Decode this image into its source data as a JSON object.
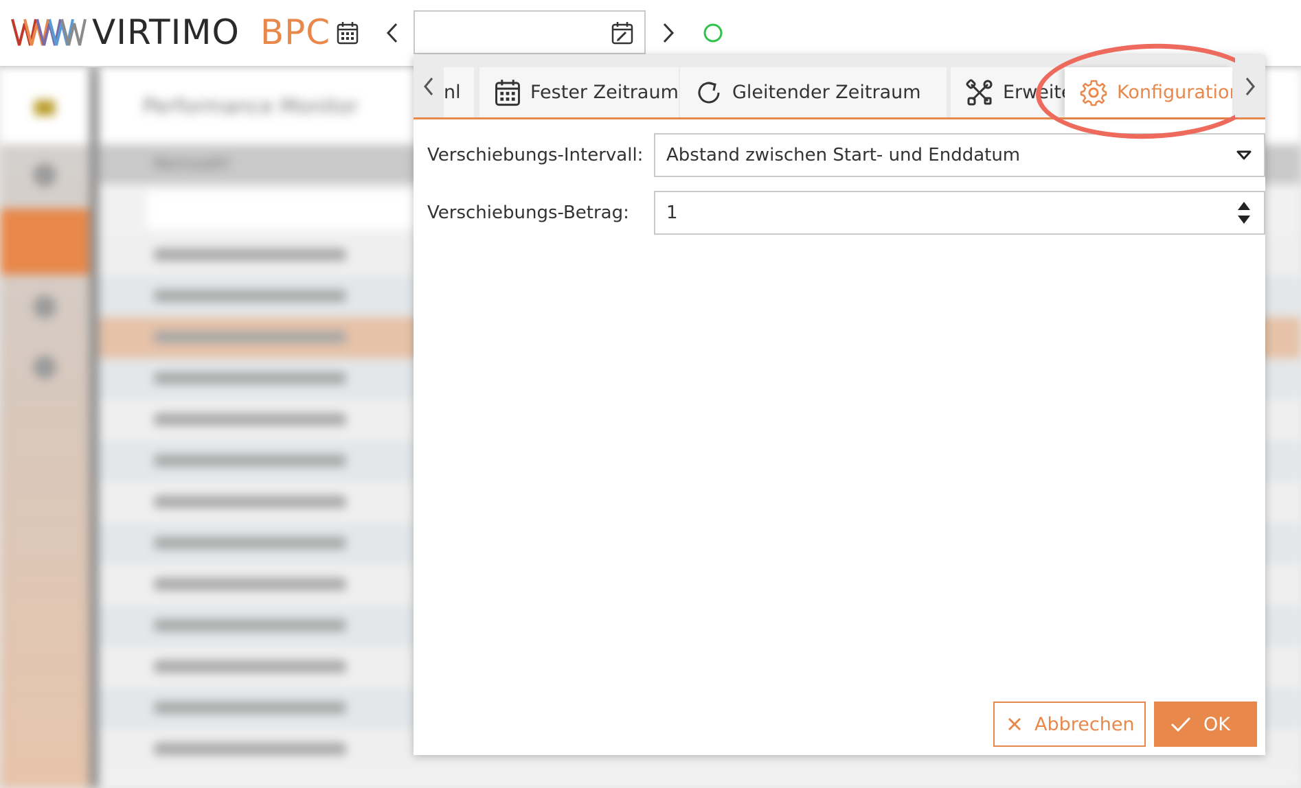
{
  "header": {
    "logo_text": "VIRTIMO",
    "logo_product": "BPC",
    "date_value": "",
    "status_color": "#2ec24a"
  },
  "background": {
    "page_title": "Performance Monitor",
    "column_header": "Kennzahl"
  },
  "dialog": {
    "tabs": [
      {
        "label": "nl",
        "icon": "truncated-tab"
      },
      {
        "label": "Fester Zeitraum",
        "icon": "calendar-icon"
      },
      {
        "label": "Gleitender Zeitraum",
        "icon": "refresh-icon"
      },
      {
        "label": "Erweitert",
        "icon": "tools-icon"
      },
      {
        "label": "Konfiguration",
        "icon": "gear-icon",
        "active": true
      }
    ],
    "fields": {
      "interval_label": "Verschiebungs-Intervall:",
      "interval_value": "Abstand zwischen Start- und Enddatum",
      "amount_label": "Verschiebungs-Betrag:",
      "amount_value": "1"
    },
    "buttons": {
      "cancel": "Abbrechen",
      "ok": "OK"
    }
  },
  "colors": {
    "accent": "#e8884b",
    "highlight": "#ee6a5d"
  }
}
